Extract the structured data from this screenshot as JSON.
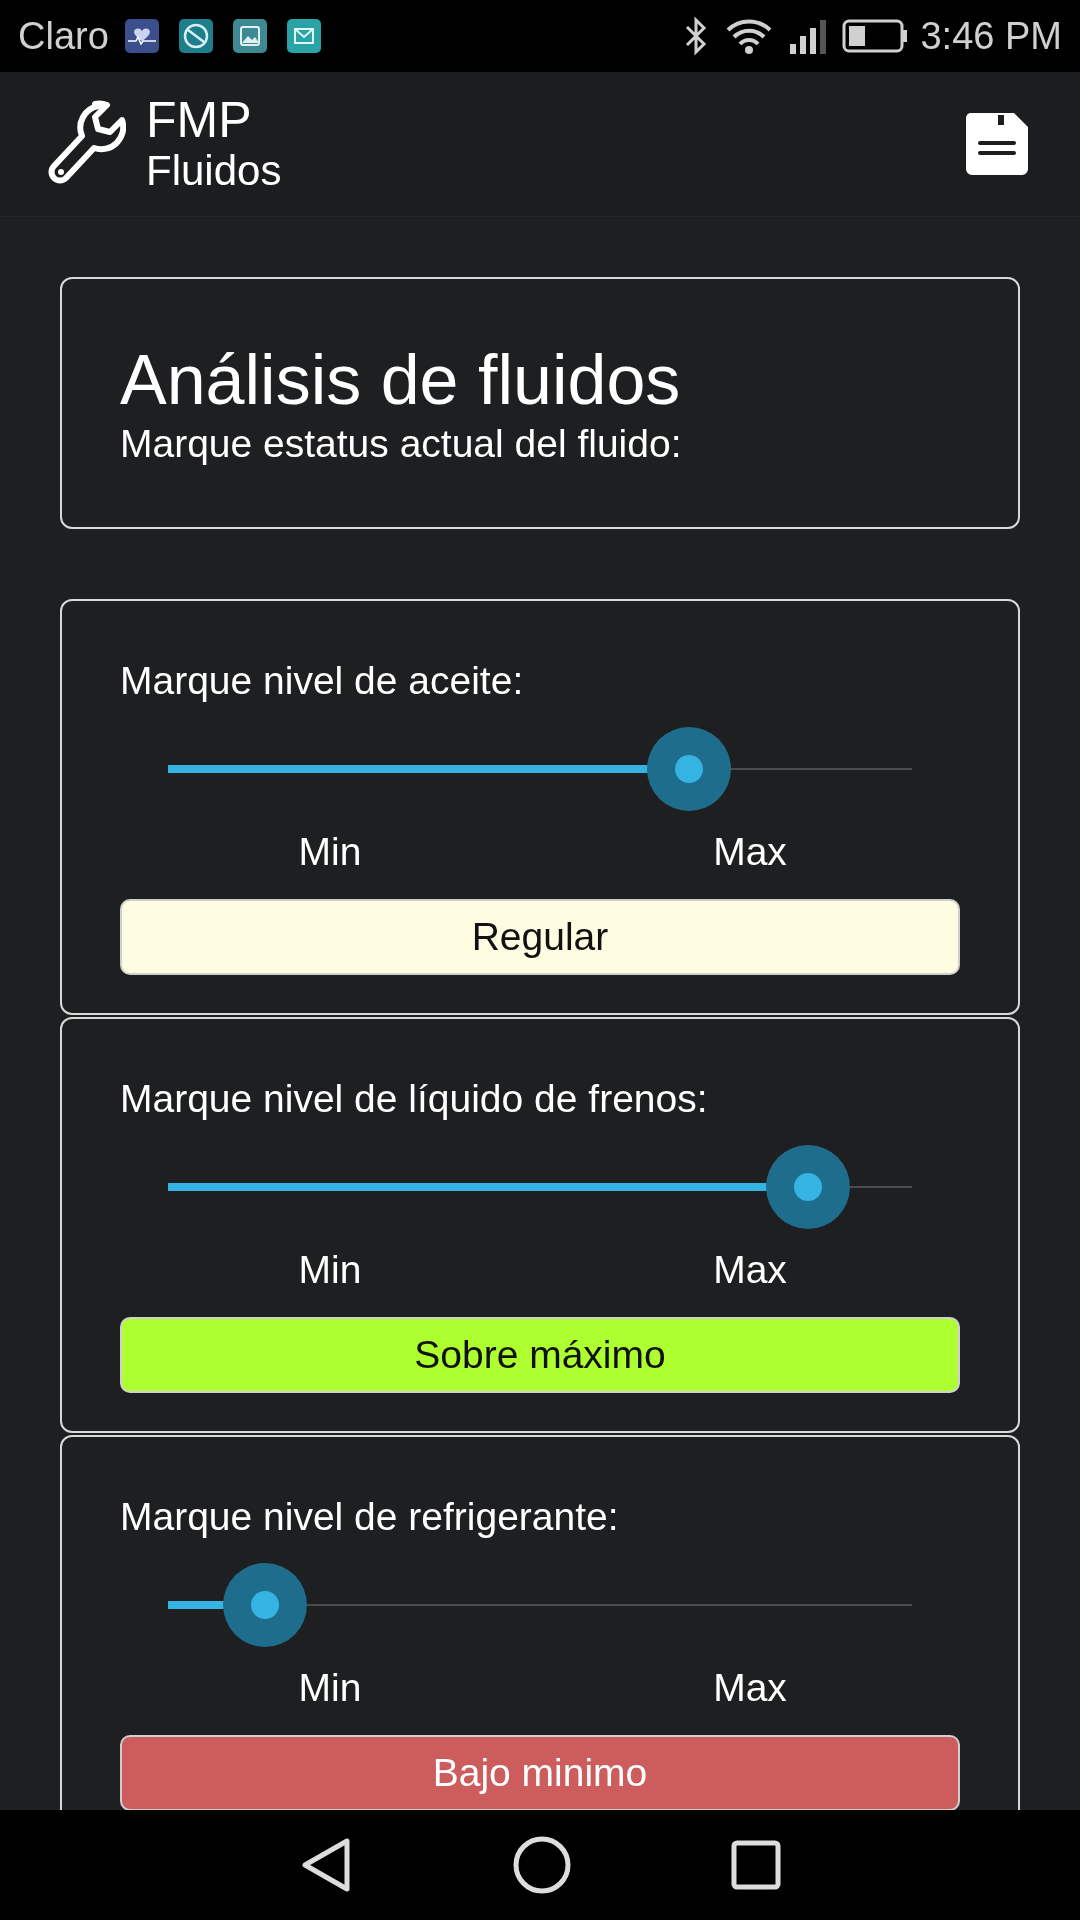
{
  "status_bar": {
    "carrier": "Claro",
    "time": "3:46 PM"
  },
  "header": {
    "title": "FMP",
    "subtitle": "Fluidos"
  },
  "intro": {
    "title": "Análisis de fluidos",
    "subtitle": "Marque estatus actual del fluido:"
  },
  "fluids": [
    {
      "label": "Marque nivel de aceite:",
      "level": 0.7,
      "min_label": "Min",
      "max_label": "Max",
      "status": "Regular",
      "color": "#fffde1"
    },
    {
      "label": "Marque nivel de líquido de frenos:",
      "level": 0.86,
      "min_label": "Min",
      "max_label": "Max",
      "status": "Sobre máximo",
      "color": "#adff2f"
    },
    {
      "label": "Marque nivel de refrigerante:",
      "level": 0.13,
      "min_label": "Min",
      "max_label": "Max",
      "status": "Bajo minimo",
      "color": "#cd5c5c"
    }
  ]
}
